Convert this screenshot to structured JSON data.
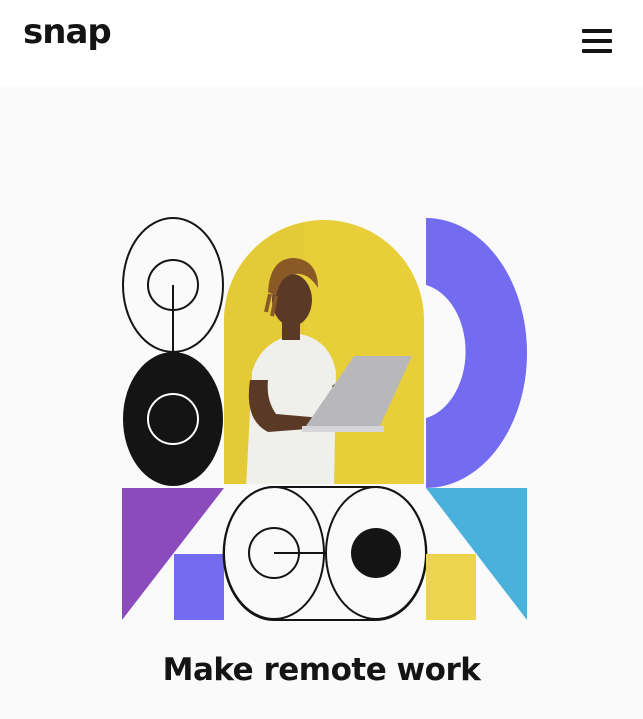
{
  "header": {
    "logo_text": "snap",
    "menu_icon": "hamburger-menu-icon"
  },
  "hero": {
    "headline": "Make remote work",
    "illustration": "geometric-shapes-with-person-holding-laptop"
  },
  "colors": {
    "header_bg": "#ffffff",
    "page_bg": "#fafafa",
    "text": "#141414",
    "yellow": "#ecd54d",
    "blue_violet": "#736cf0",
    "purple": "#8c4bbd",
    "sky_blue": "#4ab0dc"
  }
}
